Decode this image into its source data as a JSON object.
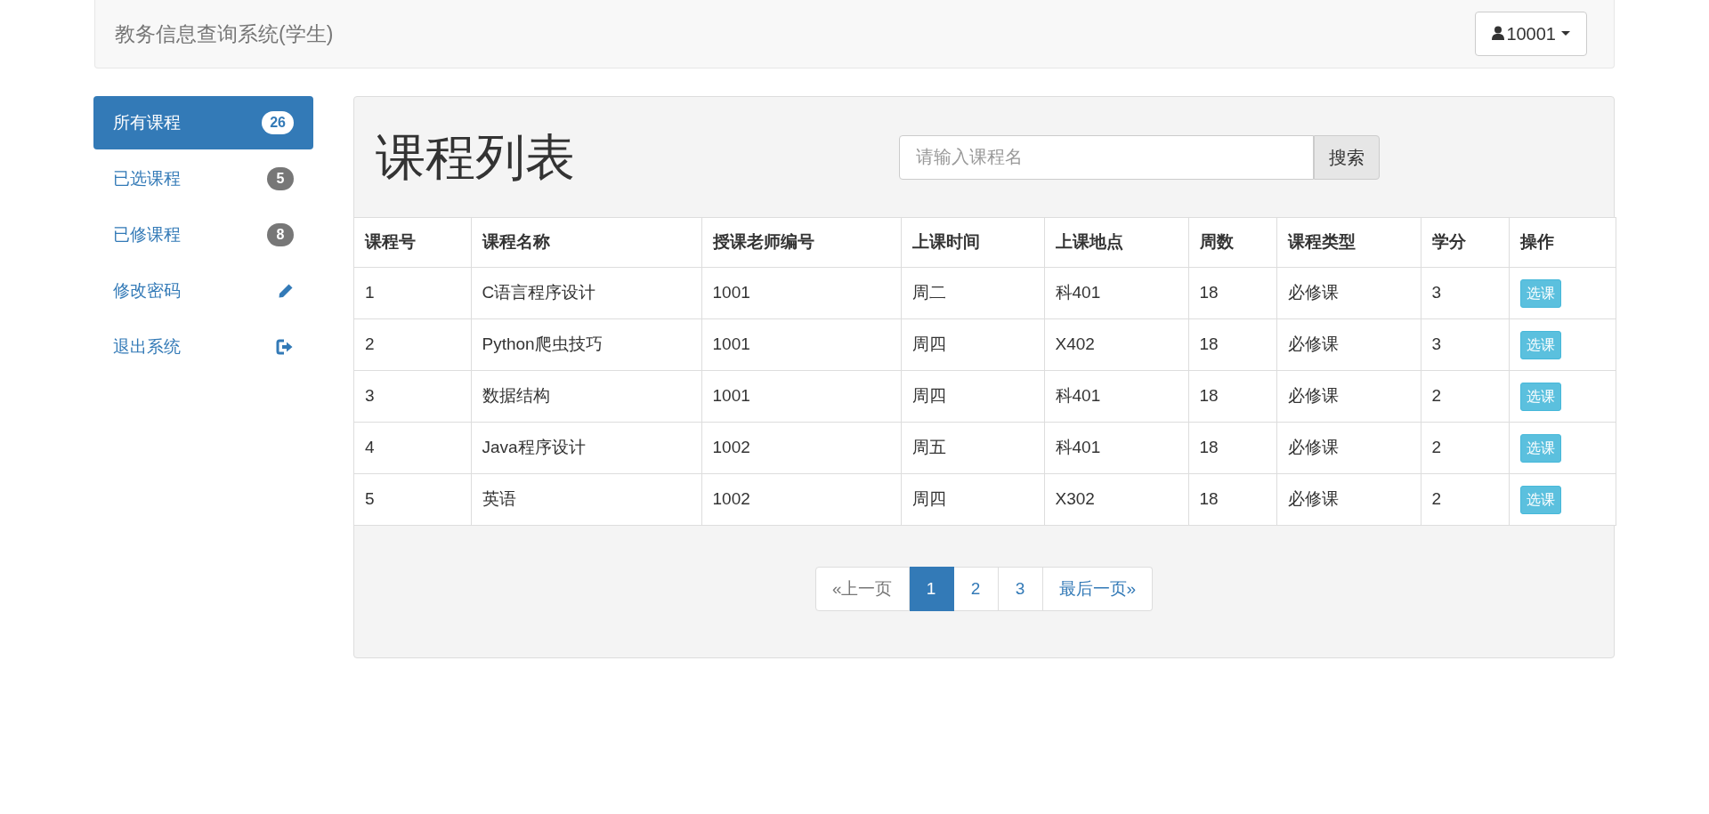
{
  "navbar": {
    "brand": "教务信息查询系统(学生)",
    "user_menu": "10001"
  },
  "sidebar": {
    "items": [
      {
        "label": "所有课程",
        "selected": true,
        "kind": "badge",
        "badge": "26"
      },
      {
        "label": "已选课程",
        "selected": false,
        "kind": "badge",
        "badge": "5"
      },
      {
        "label": "已修课程",
        "selected": false,
        "kind": "badge",
        "badge": "8"
      },
      {
        "label": "修改密码",
        "selected": false,
        "kind": "edit"
      },
      {
        "label": "退出系统",
        "selected": false,
        "kind": "logout"
      }
    ]
  },
  "panel": {
    "title": "课程列表",
    "search": {
      "placeholder": "请输入课程名",
      "button": "搜索"
    }
  },
  "table": {
    "columns": [
      "课程号",
      "课程名称",
      "授课老师编号",
      "上课时间",
      "上课地点",
      "周数",
      "课程类型",
      "学分",
      "操作"
    ],
    "rows": [
      [
        "1",
        "C语言程序设计",
        "1001",
        "周二",
        "科401",
        "18",
        "必修课",
        "3",
        "选课"
      ],
      [
        "2",
        "Python爬虫技巧",
        "1001",
        "周四",
        "X402",
        "18",
        "必修课",
        "3",
        "选课"
      ],
      [
        "3",
        "数据结构",
        "1001",
        "周四",
        "科401",
        "18",
        "必修课",
        "2",
        "选课"
      ],
      [
        "4",
        "Java程序设计",
        "1002",
        "周五",
        "科401",
        "18",
        "必修课",
        "2",
        "选课"
      ],
      [
        "5",
        "英语",
        "1002",
        "周四",
        "X302",
        "18",
        "必修课",
        "2",
        "选课"
      ]
    ]
  },
  "pagination": {
    "previous": {
      "label": "«上一页",
      "disabled": true
    },
    "pages": [
      {
        "label": "1",
        "selected": true
      },
      {
        "label": "2",
        "selected": false
      },
      {
        "label": "3",
        "selected": false
      }
    ],
    "last": {
      "label": "最后一页»",
      "disabled": false
    }
  }
}
